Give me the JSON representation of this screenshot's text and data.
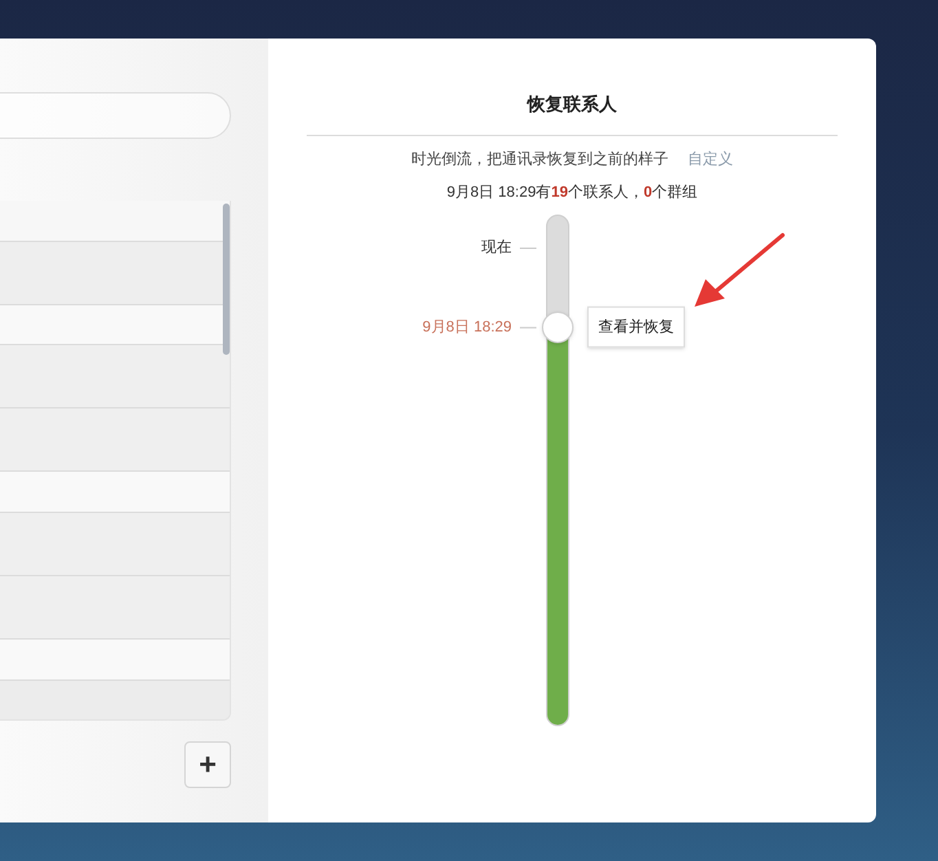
{
  "panel": {
    "title": "恢复联系人",
    "description": "时光倒流，把通讯录恢复到之前的样子",
    "custom_link": "自定义",
    "summary": "9月8日 18:29有**19**个联系人，**0**个群组"
  },
  "timeline": {
    "level": 0.78,
    "top_label": "现在",
    "selected_label": "9月8日 18:29",
    "tooltip": "查看并恢复"
  },
  "add_button": "+"
}
